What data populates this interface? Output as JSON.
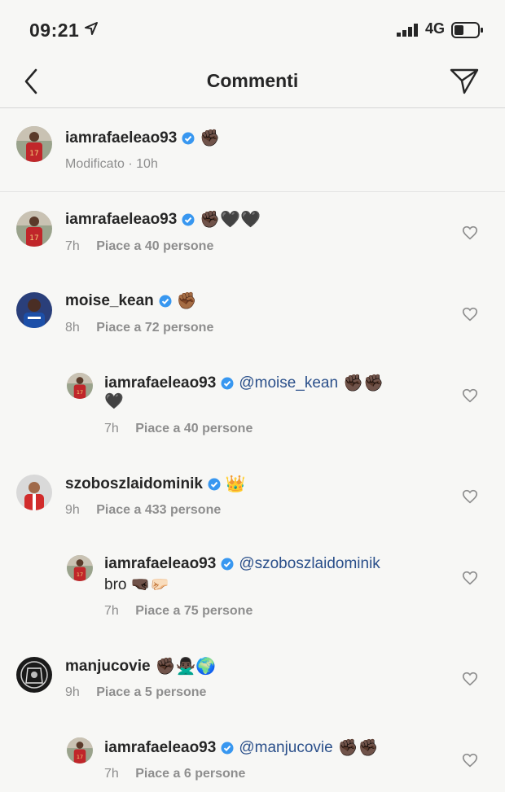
{
  "status": {
    "time": "09:21",
    "network": "4G"
  },
  "header": {
    "title": "Commenti"
  },
  "caption": {
    "username": "iamrafaeleao93",
    "emoji": "✊🏿",
    "meta": "Modificato · 10h"
  },
  "comments": [
    {
      "username": "iamrafaeleao93",
      "text": "✊🏿🖤🖤",
      "time": "7h",
      "likes": "Piace a 40 persone"
    },
    {
      "username": "moise_kean",
      "text": "✊🏾",
      "time": "8h",
      "likes": "Piace a 72 persone"
    },
    {
      "username": "iamrafaeleao93",
      "mention": "@moise_kean",
      "text": "✊🏿✊🏿",
      "text2": "🖤",
      "time": "7h",
      "likes": "Piace a 40 persone"
    },
    {
      "username": "szoboszlaidominik",
      "text": "👑",
      "time": "9h",
      "likes": "Piace a 433 persone"
    },
    {
      "username": "iamrafaeleao93",
      "mention": "@szoboszlaidominik",
      "text2": "bro 🤜🏿🤛🏻",
      "time": "7h",
      "likes": "Piace a 75 persone"
    },
    {
      "username": "manjucovie",
      "text": "✊🏿🙅🏿‍♂️🌍",
      "time": "9h",
      "likes": "Piace a 5 persone"
    },
    {
      "username": "iamrafaeleao93",
      "mention": "@manjucovie",
      "text": "✊🏿✊🏿",
      "time": "7h",
      "likes": "Piace a 6 persone"
    }
  ]
}
